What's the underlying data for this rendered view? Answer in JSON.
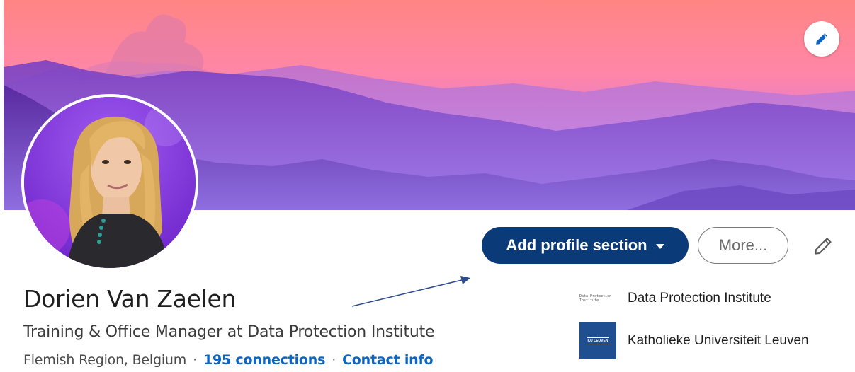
{
  "profile": {
    "name": "Dorien Van Zaelen",
    "headline": "Training & Office Manager at Data Protection Institute",
    "location": "Flemish Region, Belgium",
    "separator": "·",
    "connections": "195 connections",
    "contact_info": "Contact info"
  },
  "actions": {
    "add_section_label": "Add profile section",
    "more_label": "More..."
  },
  "organizations": [
    {
      "name": "Data Protection Institute",
      "logo_text": "Data Protection Institute"
    },
    {
      "name": "Katholieke Universiteit Leuven",
      "logo_text": "KU LEUVEN"
    }
  ],
  "icons": {
    "banner_edit": "pencil-icon",
    "profile_edit": "pencil-icon",
    "add_section_caret": "caret-down-icon"
  },
  "colors": {
    "primary_button": "#0a3a78",
    "link": "#0a66c2",
    "banner_sky_top": "#ff8a8a",
    "banner_mountains": "#5a2fa0"
  }
}
